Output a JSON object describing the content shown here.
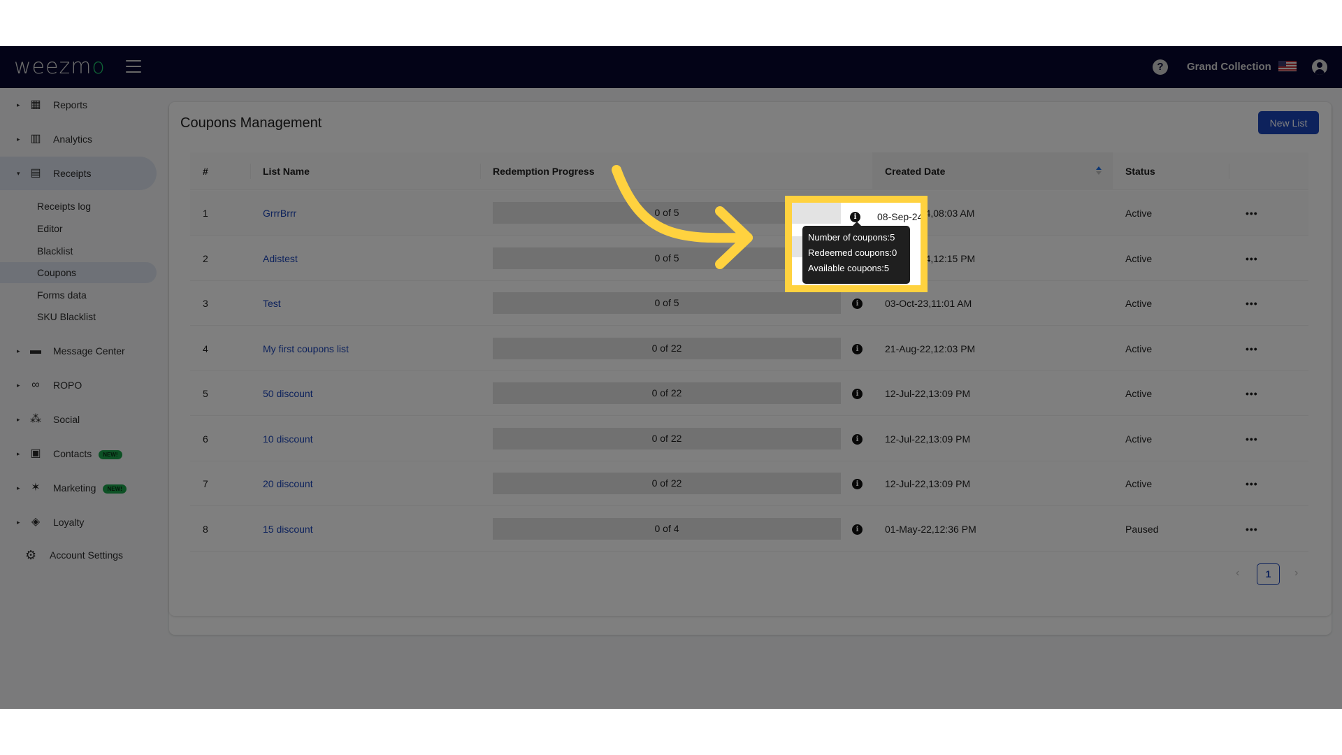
{
  "app": {
    "logo_text": "weezm",
    "logo_accent": "o",
    "org_name": "Grand Collection",
    "colors": {
      "navbar": "#06072e",
      "accent": "#1a44b8",
      "logo_accent": "#1ec46b",
      "new_badge": "#1aa34a",
      "highlight": "#ffd23f"
    }
  },
  "sidebar": {
    "items": [
      {
        "label": "Reports",
        "icon": "dashboard-icon",
        "expanded": false
      },
      {
        "label": "Analytics",
        "icon": "bar-chart-icon",
        "expanded": false
      },
      {
        "label": "Receipts",
        "icon": "receipt-icon",
        "expanded": true,
        "children": [
          "Receipts log",
          "Editor",
          "Blacklist",
          "Coupons",
          "Forms data",
          "SKU Blacklist"
        ],
        "active_child": "Coupons"
      },
      {
        "label": "Message Center",
        "icon": "chat-icon",
        "expanded": false
      },
      {
        "label": "ROPO",
        "icon": "infinity-icon",
        "expanded": false
      },
      {
        "label": "Social",
        "icon": "people-icon",
        "expanded": false
      },
      {
        "label": "Contacts",
        "icon": "contacts-icon",
        "expanded": false,
        "badge": "NEW!"
      },
      {
        "label": "Marketing",
        "icon": "party-popper-icon",
        "expanded": false,
        "badge": "NEW!"
      },
      {
        "label": "Loyalty",
        "icon": "tag-icon",
        "expanded": false
      }
    ],
    "account_settings": "Account Settings"
  },
  "main": {
    "title": "Coupons Management",
    "new_list_label": "New List",
    "columns": [
      "#",
      "List Name",
      "Redemption Progress",
      "Created Date",
      "Status",
      ""
    ],
    "sorted_column": "Created Date",
    "rows": [
      {
        "idx": "1",
        "name": "GrrrBrrr",
        "redeemed": 0,
        "total": 5,
        "progress_text": "0 of 5",
        "created": "08-Sep-24,08:03 AM",
        "status": "Active"
      },
      {
        "idx": "2",
        "name": "Adistest",
        "redeemed": 0,
        "total": 5,
        "progress_text": "0 of 5",
        "created": "03-Sep-24,12:15 PM",
        "status": "Active"
      },
      {
        "idx": "3",
        "name": "Test",
        "redeemed": 0,
        "total": 5,
        "progress_text": "0 of 5",
        "created": "03-Oct-23,11:01 AM",
        "status": "Active"
      },
      {
        "idx": "4",
        "name": "My first coupons list",
        "redeemed": 0,
        "total": 22,
        "progress_text": "0 of 22",
        "created": "21-Aug-22,12:03 PM",
        "status": "Active"
      },
      {
        "idx": "5",
        "name": "50 discount",
        "redeemed": 0,
        "total": 22,
        "progress_text": "0 of 22",
        "created": "12-Jul-22,13:09 PM",
        "status": "Active"
      },
      {
        "idx": "6",
        "name": "10 discount",
        "redeemed": 0,
        "total": 22,
        "progress_text": "0 of 22",
        "created": "12-Jul-22,13:09 PM",
        "status": "Active"
      },
      {
        "idx": "7",
        "name": "20 discount",
        "redeemed": 0,
        "total": 22,
        "progress_text": "0 of 22",
        "created": "12-Jul-22,13:09 PM",
        "status": "Active"
      },
      {
        "idx": "8",
        "name": "15 discount",
        "redeemed": 0,
        "total": 4,
        "progress_text": "0 of 4",
        "created": "01-May-22,12:36 PM",
        "status": "Paused"
      }
    ],
    "more_label": "•••",
    "info_glyph": "i",
    "pagination": {
      "prev": "‹",
      "current": "1",
      "next": "›"
    }
  },
  "tooltip": {
    "lines": [
      "Number of coupons:5",
      "Redeemed coupons:0",
      "Available coupons:5"
    ]
  },
  "glyphs": {
    "caret_right": "▸",
    "caret_down": "▾",
    "help": "?",
    "gear": "⚙"
  }
}
